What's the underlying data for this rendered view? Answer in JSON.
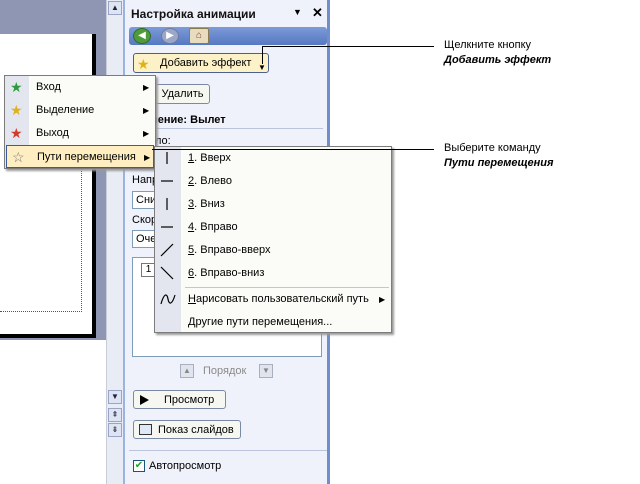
{
  "pane": {
    "title": "Настройка анимации",
    "dropdown_glyph": "▼",
    "close_glyph": "✕",
    "add_effect_label": "Добавить эффект",
    "remove_label": "Удалить",
    "change_label": "енение: Вылет",
    "start_label": "ло:",
    "direction_label": "Напр",
    "direction_value": "Сни",
    "speed_label": "Скор",
    "speed_value": "Оче",
    "list_first_number": "1",
    "order_label": "Порядок",
    "play_label": "Просмотр",
    "slideshow_label": "Показ слайдов",
    "autopreview_label": "Автопросмотр",
    "autopreview_checked": true
  },
  "effect_menu": {
    "items": [
      {
        "label": "Вход",
        "icon": "star-green-icon"
      },
      {
        "label": "Выделение",
        "icon": "star-yellow-icon"
      },
      {
        "label": "Выход",
        "icon": "star-red-icon"
      },
      {
        "label": "Пути перемещения",
        "icon": "star-outline-icon",
        "selected": true
      }
    ]
  },
  "path_menu": {
    "items": [
      {
        "key": "1",
        "rest": ". Вверх",
        "icon": "vertical-line-icon"
      },
      {
        "key": "2",
        "rest": ". Влево",
        "icon": "horizontal-line-icon"
      },
      {
        "key": "3",
        "rest": ". Вниз",
        "icon": "vertical-line-icon"
      },
      {
        "key": "4",
        "rest": ". Вправо",
        "icon": "horizontal-line-icon"
      },
      {
        "key": "5",
        "rest": ". Вправо-вверх",
        "icon": "diagonal-up-icon"
      },
      {
        "key": "6",
        "rest": ". Вправо-вниз",
        "icon": "diagonal-down-icon"
      }
    ],
    "custom_path": {
      "key": "Н",
      "rest": "арисовать пользовательский путь"
    },
    "more_paths": {
      "key": "Д",
      "rest": "ругие пути перемещения..."
    }
  },
  "callouts": {
    "c1_line1": "Щелкните кнопку",
    "c1_line2": "Добавить эффект",
    "c2_line1": "Выберите команду",
    "c2_line2": "Пути перемещения"
  }
}
